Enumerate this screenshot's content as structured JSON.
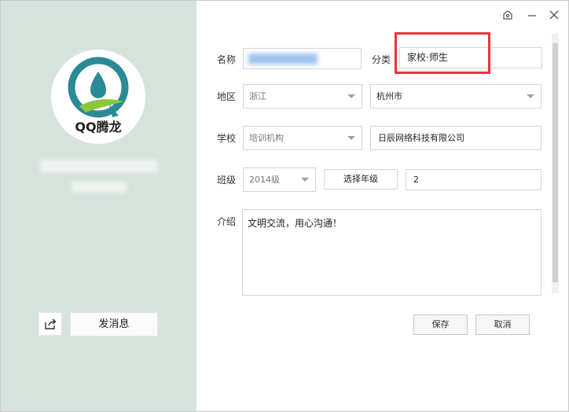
{
  "profile": {
    "logo_text": "QQ腾龙",
    "send_message_label": "发消息"
  },
  "form": {
    "name_label": "名称",
    "category_label": "分类",
    "category_value": "家校·师生",
    "region_label": "地区",
    "province_value": "浙江",
    "city_value": "杭州市",
    "school_label": "学校",
    "school_type_value": "培训机构",
    "school_name_value": "日辰网络科技有限公司",
    "class_label": "班级",
    "year_value": "2014级",
    "grade_button_label": "选择年级",
    "class_number_value": "2",
    "intro_label": "介绍",
    "intro_value": "文明交流，用心沟通！"
  },
  "actions": {
    "save_label": "保存",
    "cancel_label": "取消"
  },
  "colors": {
    "sidebar_bg": "#d5e3dc",
    "highlight": "#e8343b",
    "logo_teal": "#2b8a96",
    "logo_green": "#8cc63f"
  }
}
